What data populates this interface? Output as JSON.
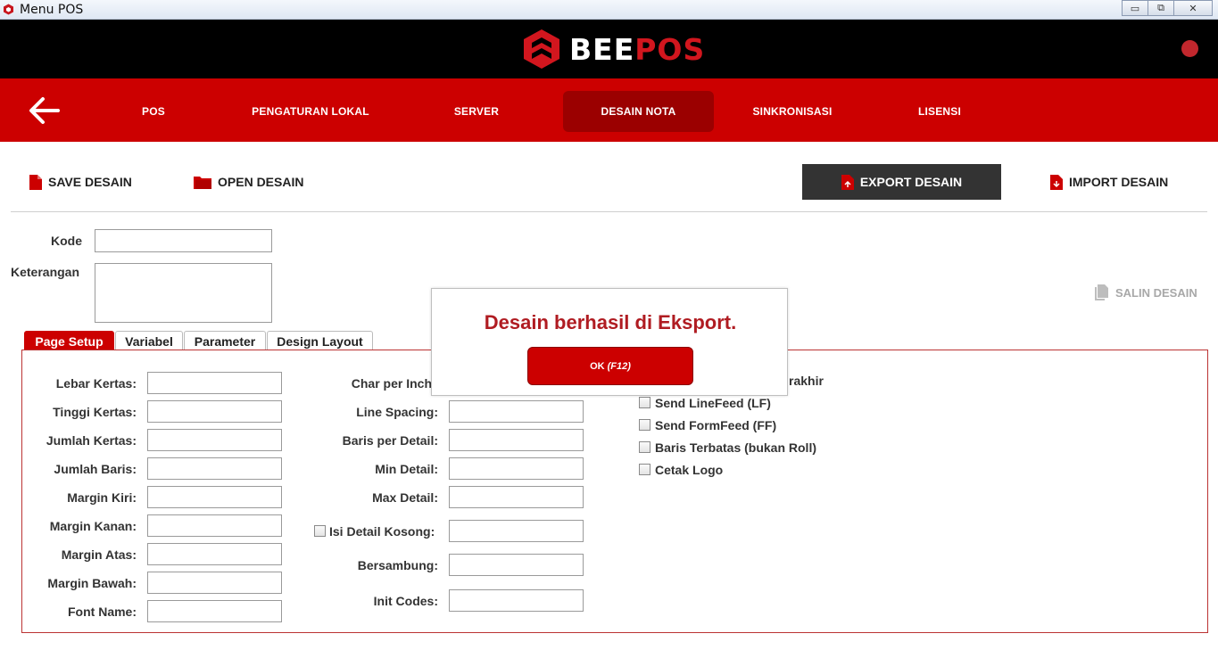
{
  "window": {
    "title": "Menu POS",
    "min_label": "▭",
    "max_label": "⧉",
    "close_label": "✕"
  },
  "brand": {
    "part1": "BEE",
    "part2": "POS",
    "accent": "#cc0000"
  },
  "nav": {
    "back_icon": "arrow-left-icon",
    "items": [
      {
        "label": "POS"
      },
      {
        "label": "PENGATURAN LOKAL"
      },
      {
        "label": "SERVER"
      },
      {
        "label": "DESAIN NOTA",
        "active": true
      },
      {
        "label": "SINKRONISASI"
      },
      {
        "label": "LISENSI"
      }
    ]
  },
  "toolbar": {
    "save_label": "SAVE DESAIN",
    "open_label": "OPEN DESAIN",
    "export_label": "EXPORT DESAIN",
    "import_label": "IMPORT DESAIN",
    "salin_label": "SALIN DESAIN"
  },
  "form": {
    "kode_label": "Kode",
    "kode_value": "",
    "keterangan_label": "Keterangan",
    "keterangan_value": ""
  },
  "tabs": [
    {
      "label": "Page Setup",
      "active": true
    },
    {
      "label": "Variabel"
    },
    {
      "label": "Parameter"
    },
    {
      "label": "Design Layout"
    }
  ],
  "page_setup": {
    "left_fields": [
      {
        "label": "Lebar Kertas:",
        "value": ""
      },
      {
        "label": "Tinggi Kertas:",
        "value": ""
      },
      {
        "label": "Jumlah Kertas:",
        "value": ""
      },
      {
        "label": "Jumlah Baris:",
        "value": ""
      },
      {
        "label": "Margin Kiri:",
        "value": ""
      },
      {
        "label": "Margin Kanan:",
        "value": ""
      },
      {
        "label": "Margin Atas:",
        "value": ""
      },
      {
        "label": "Margin Bawah:",
        "value": ""
      },
      {
        "label": "Font Name:",
        "value": ""
      }
    ],
    "char_per_inch_label": "Char per Inch",
    "mid_fields": [
      {
        "label": "Line Spacing:",
        "value": ""
      },
      {
        "label": "Baris per Detail:",
        "value": ""
      },
      {
        "label": "Min Detail:",
        "value": ""
      },
      {
        "label": "Max Detail:",
        "value": ""
      }
    ],
    "isi_detail_label": "Isi Detail Kosong:",
    "isi_detail_value": "",
    "bersambung_label": "Bersambung:",
    "bersambung_value": "",
    "init_codes_label": "Init Codes:",
    "init_codes_value": "",
    "partial_checkbox_text": "rakhir",
    "checkboxes": [
      {
        "label": "Send LineFeed (LF)",
        "checked": false
      },
      {
        "label": "Send FormFeed (FF)",
        "checked": false
      },
      {
        "label": "Baris Terbatas (bukan Roll)",
        "checked": false
      },
      {
        "label": "Cetak Logo",
        "checked": false
      }
    ]
  },
  "dialog": {
    "message": "Desain berhasil di Eksport.",
    "ok_label": "OK",
    "ok_shortcut": "(F12)"
  }
}
